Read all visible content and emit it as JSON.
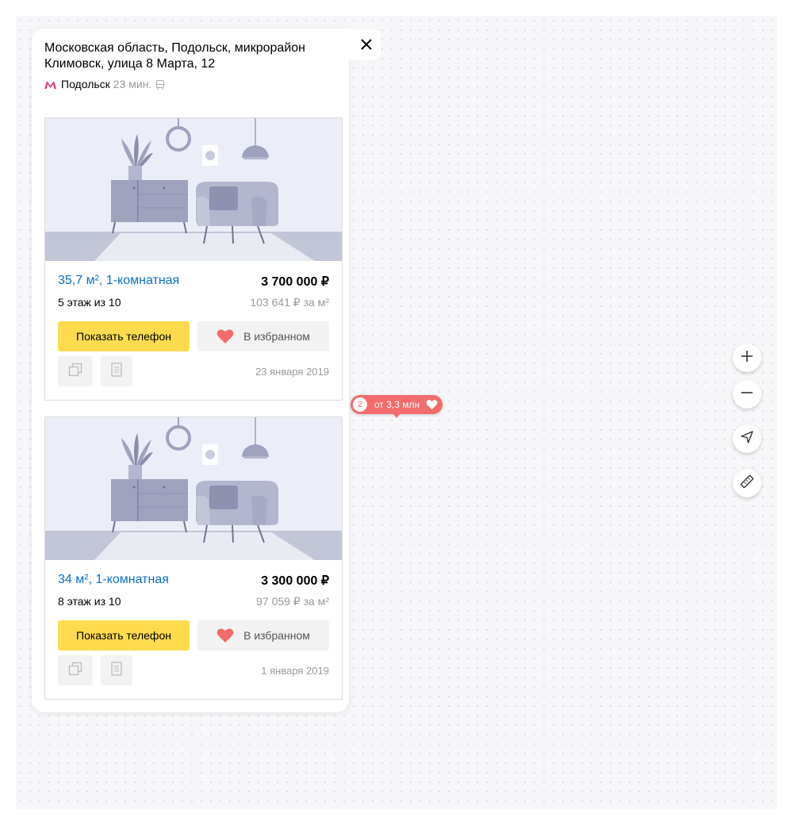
{
  "address": {
    "line1": "Московская область, Подольск, микрорайон",
    "line2": "Климовск, улица 8 Марта, 12"
  },
  "metro": {
    "station": "Подольск",
    "time": "23 мин.",
    "icon": "metro-icon",
    "transport_icon": "bus-icon",
    "color": "#e4407b"
  },
  "listings": [
    {
      "title": "35,7 м², 1-комнатная",
      "price": "3 700 000 ₽",
      "floor": "5 этаж из 10",
      "price_per_m2": "103 641 ₽ за м²",
      "phone_button": "Показать телефон",
      "fav_button": "В избранном",
      "date": "23 января 2019"
    },
    {
      "title": "34 м², 1-комнатная",
      "price": "3 300 000 ₽",
      "floor": "8 этаж из 10",
      "price_per_m2": "97 059 ₽ за м²",
      "phone_button": "Показать телефон",
      "fav_button": "В избранном",
      "date": "1 января 2019"
    }
  ],
  "marker": {
    "count": "2",
    "label": "от 3,3 млн",
    "color": "#f46b6b"
  },
  "colors": {
    "accent_yellow": "#ffdb4d",
    "link_blue": "#0a6fcc",
    "favorite_red": "#f46b6b"
  }
}
